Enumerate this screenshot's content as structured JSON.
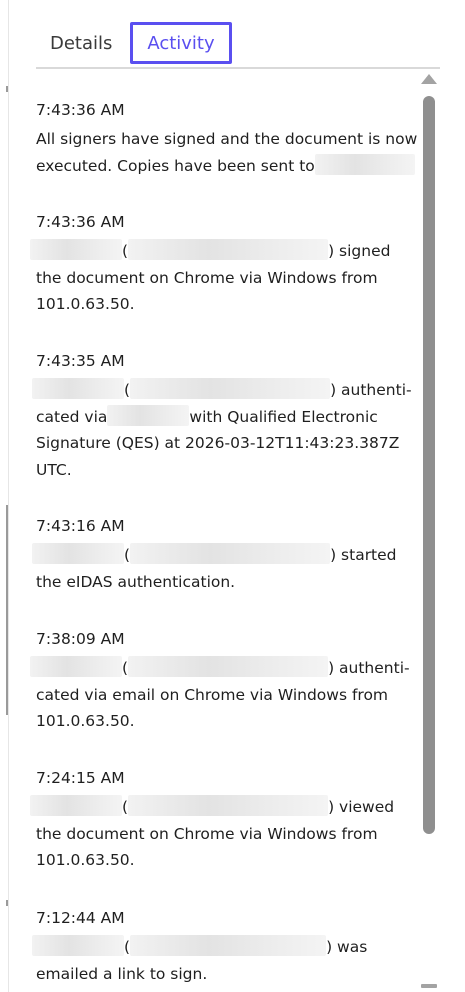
{
  "tabs": {
    "details": "Details",
    "activity": "Activity"
  },
  "entries": [
    {
      "time": "7:43:36 AM",
      "line1": "All signers have signed and the document is now",
      "line2": "executed. Copies have been sent to"
    },
    {
      "time": "7:43:36 AM",
      "l1_open": "(",
      "l1_close": ") signed",
      "line2": "the document on Chrome via Windows from",
      "line3": "101.0.63.50."
    },
    {
      "time": "7:43:35 AM",
      "l1_open": "(",
      "l1_close": ") authenti-",
      "l2_pre": "cated via",
      "l2_post": "with Qualified Electronic",
      "line3": "Signature (QES) at 2026-03-12T11:43:23.387Z",
      "line4": "UTC."
    },
    {
      "time": "7:43:16 AM",
      "l1_open": "(",
      "l1_close": ") started",
      "line2": "the eIDAS authentication."
    },
    {
      "time": "7:38:09 AM",
      "l1_open": "(",
      "l1_close": ") authenti-",
      "line2": "cated via email on Chrome via Windows from",
      "line3": "101.0.63.50."
    },
    {
      "time": "7:24:15 AM",
      "l1_open": "(",
      "l1_close": ") viewed",
      "line2": "the document on Chrome via Windows from",
      "line3": "101.0.63.50."
    },
    {
      "time": "7:12:44 AM",
      "l1_open": "(",
      "l1_close": ") was",
      "line2": "emailed a link to sign."
    }
  ],
  "colors": {
    "accent": "#5a4ff0",
    "text": "#1f1f1f",
    "scrollbar": "#8f8f8f"
  }
}
